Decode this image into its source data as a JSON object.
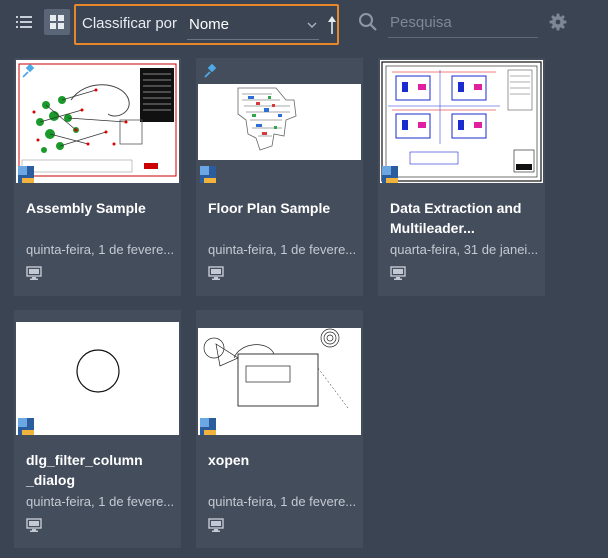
{
  "toolbar": {
    "sort_label": "Classificar por",
    "sort_value": "Nome",
    "search_placeholder": "Pesquisa"
  },
  "colors": {
    "background": "#3b4453",
    "card": "#444d5c",
    "accent_outline": "#e8862b",
    "pin": "#4fa8e8"
  },
  "cards": [
    {
      "title": "Assembly Sample",
      "date": "quinta-feira, 1 de fevere...",
      "pinned": true,
      "device_icon": "computer-icon"
    },
    {
      "title": "Floor Plan Sample",
      "date": "quinta-feira, 1 de fevere...",
      "pinned": true,
      "device_icon": "computer-icon"
    },
    {
      "title": "Data Extraction and Multileader...",
      "date": "quarta-feira, 31 de janei...",
      "pinned": false,
      "device_icon": "computer-icon"
    },
    {
      "title": "dlg_filter_column _dialog",
      "date": "quinta-feira, 1 de fevere...",
      "pinned": false,
      "device_icon": "computer-icon"
    },
    {
      "title": "xopen",
      "date": "quinta-feira, 1 de fevere...",
      "pinned": false,
      "device_icon": "computer-icon"
    }
  ]
}
